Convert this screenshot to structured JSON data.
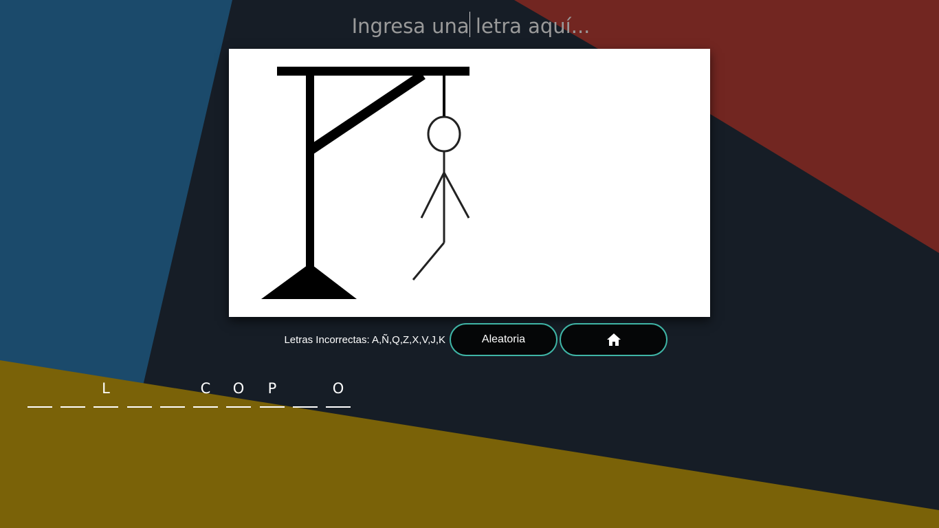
{
  "input": {
    "placeholder": "Ingresa una letra aquí..."
  },
  "wrong_letters": {
    "text": "Letras Incorrectas: A,Ñ,Q,Z,X,V,J,K"
  },
  "buttons": {
    "random_label": "Aleatoria",
    "home_icon": "home-icon"
  },
  "word_slots": [
    "",
    "",
    "L",
    "",
    "",
    "C",
    "O",
    "P",
    "",
    "O"
  ],
  "hangman": {
    "parts_shown": [
      "head",
      "body",
      "left-arm",
      "right-arm",
      "left-leg"
    ]
  },
  "colors": {
    "background": "#161d26",
    "shape_blue": "#1b4a6b",
    "shape_red": "#722621",
    "shape_gold": "#7a6208",
    "button_border": "#3fb5a6",
    "button_fill": "#050607"
  }
}
